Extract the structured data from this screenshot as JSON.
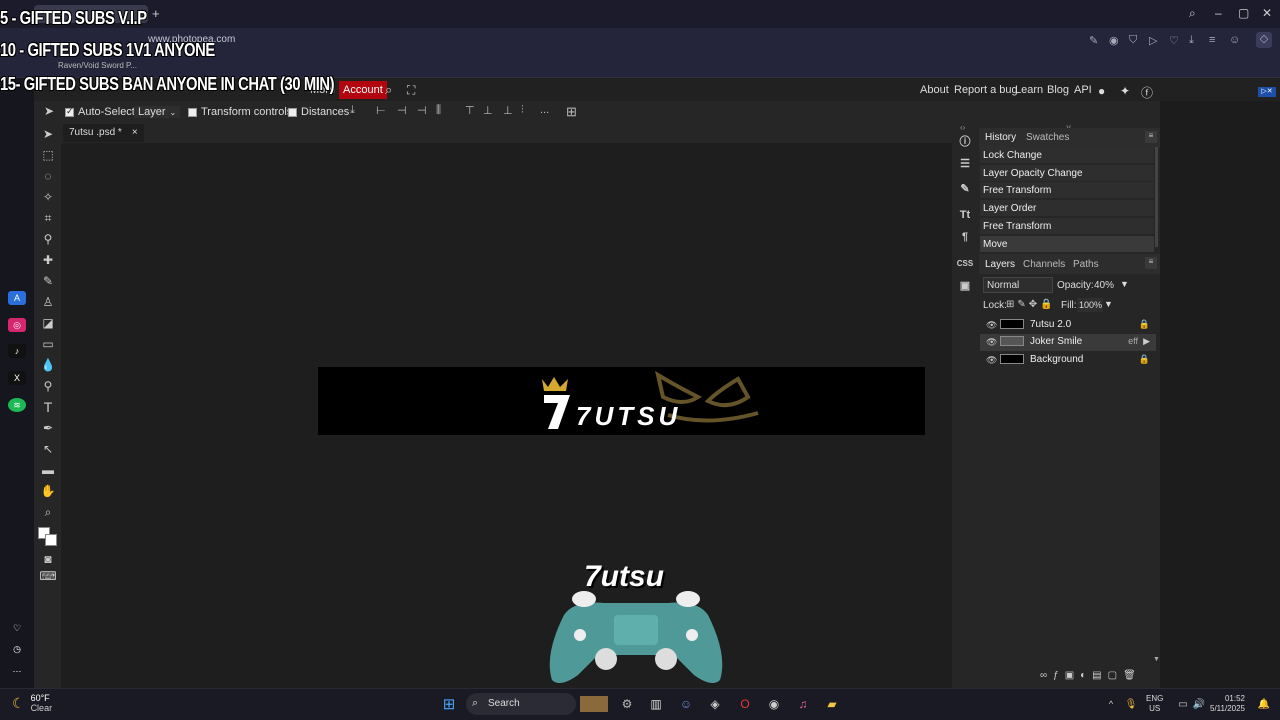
{
  "browser": {
    "url": "www.photopea.com",
    "bookmark": "Raven/Void Sword P..."
  },
  "overlay": {
    "line1": "5 - GIFTED SUBS V.I.P",
    "line2": "10 - GIFTED SUBS 1v1 ANYONE",
    "line3": "15- GIFTED SUBS BAN ANYONE IN CHAT (30 MIN)"
  },
  "menubar": {
    "more": "More",
    "account": "Account",
    "about": "About",
    "report": "Report a bug",
    "learn": "Learn",
    "blog": "Blog",
    "api": "API"
  },
  "options": {
    "auto_select": "Auto-Select",
    "layer_dropdown": "Layer",
    "transform_controls": "Transform controls",
    "distances": "Distances",
    "more": "..."
  },
  "document": {
    "tab_title": "7utsu .psd *",
    "close": "×",
    "canvas_text": "7UTSU"
  },
  "history": {
    "tab_history": "History",
    "tab_swatches": "Swatches",
    "items": [
      "Lock Change",
      "Layer Opacity Change",
      "Free Transform",
      "Layer Order",
      "Free Transform",
      "Move"
    ]
  },
  "layers": {
    "tab_layers": "Layers",
    "tab_channels": "Channels",
    "tab_paths": "Paths",
    "blend_mode": "Normal",
    "opacity_label": "Opacity:",
    "opacity_value": "40%",
    "lock_label": "Lock:",
    "fill_label": "Fill:",
    "fill_value": "100%",
    "items": [
      {
        "name": "7utsu 2.0"
      },
      {
        "name": "Joker Smile"
      },
      {
        "name": "Background"
      }
    ],
    "eff": "eff"
  },
  "right_icons": {
    "css": "CSS"
  },
  "taskbar": {
    "temp": "60°F",
    "condition": "Clear",
    "search": "Search",
    "lang1": "ENG",
    "lang2": "US",
    "time": "01:52",
    "date": "5/11/2025"
  },
  "controller_logo": "7utsu"
}
